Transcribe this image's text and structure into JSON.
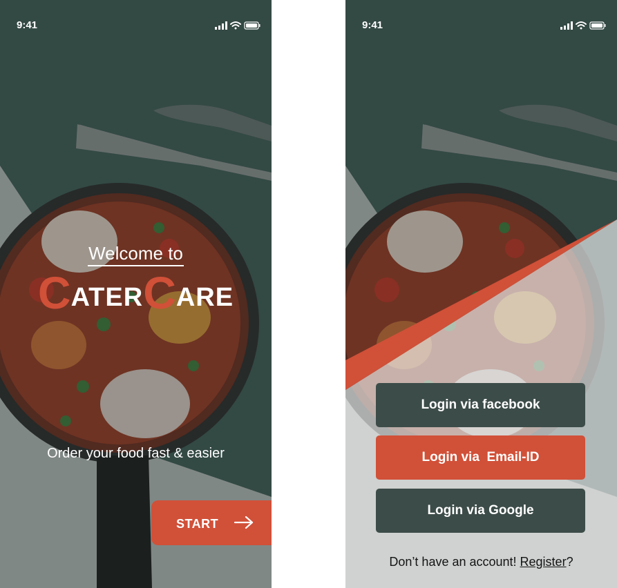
{
  "status_bar": {
    "time": "9:41"
  },
  "welcome": {
    "welcome_text": "Welcome to",
    "brand": {
      "c1": "C",
      "part1": "ATER",
      "c2": "C",
      "part2": "ARE"
    },
    "tagline": "Order your food fast & easier",
    "start_label": "START"
  },
  "login": {
    "facebook_label": "Login via facebook",
    "email_label": "Login via  Email-ID",
    "google_label": "Login via Google",
    "register_prompt": "Don’t have an account! ",
    "register_link": "Register",
    "register_suffix": "?"
  },
  "colors": {
    "accent": "#d15038",
    "button_dark": "#3c4c49",
    "background": "#3d5a55"
  },
  "icons": [
    "signal-icon",
    "wifi-icon",
    "battery-icon",
    "arrow-right-icon"
  ]
}
